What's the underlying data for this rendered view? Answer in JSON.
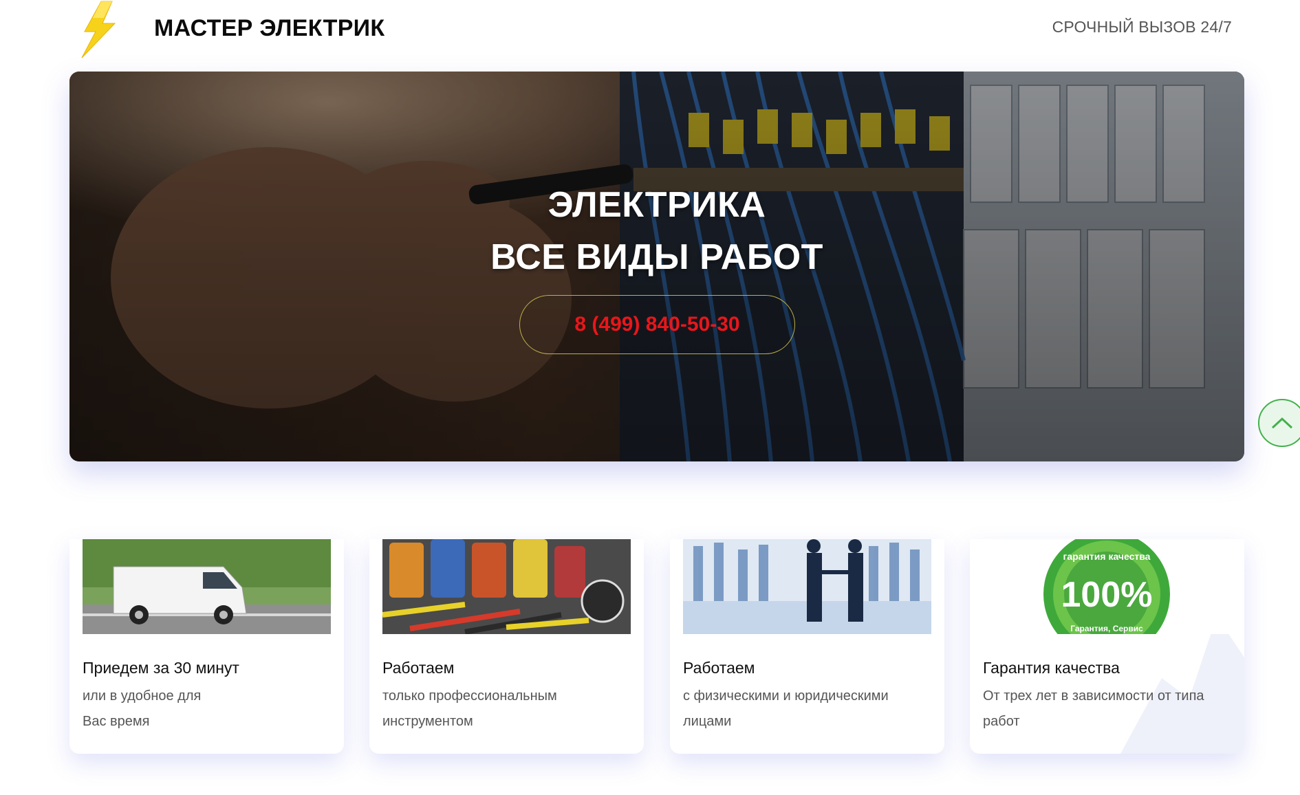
{
  "header": {
    "brand": "МАСТЕР ЭЛЕКТРИК",
    "urgent_label": "СРОЧНЫЙ ВЫЗОВ 24/7",
    "logo_icon": "lightning-bolt-icon"
  },
  "hero": {
    "title_line1": "ЭЛЕКТРИКА",
    "title_line2": "ВСЕ ВИДЫ РАБОТ",
    "phone": "8 (499) 840-50-30",
    "phone_color": "#e8161b"
  },
  "scroll_top": {
    "icon": "chevron-up-icon",
    "color": "#43b14b"
  },
  "cards": [
    {
      "title": "Приедем за 30 минут",
      "desc_line1": "или в удобное для",
      "desc_line2": "Вас время",
      "image": "white-van"
    },
    {
      "title": "Работаем",
      "desc_line1": "только профессиональным",
      "desc_line2": "инструментом",
      "image": "tools"
    },
    {
      "title": "Работаем",
      "desc_line1": "с физическими и юридическими",
      "desc_line2": "лицами",
      "image": "business-people"
    },
    {
      "title": "Гарантия качества",
      "desc_line1": "От трех лет в зависимости от типа",
      "desc_line2": "работ",
      "image": "quality-seal",
      "seal_text_top": "гарантия качества",
      "seal_text_big": "100%",
      "seal_text_bottom": "Гарантия, Сервис"
    }
  ]
}
